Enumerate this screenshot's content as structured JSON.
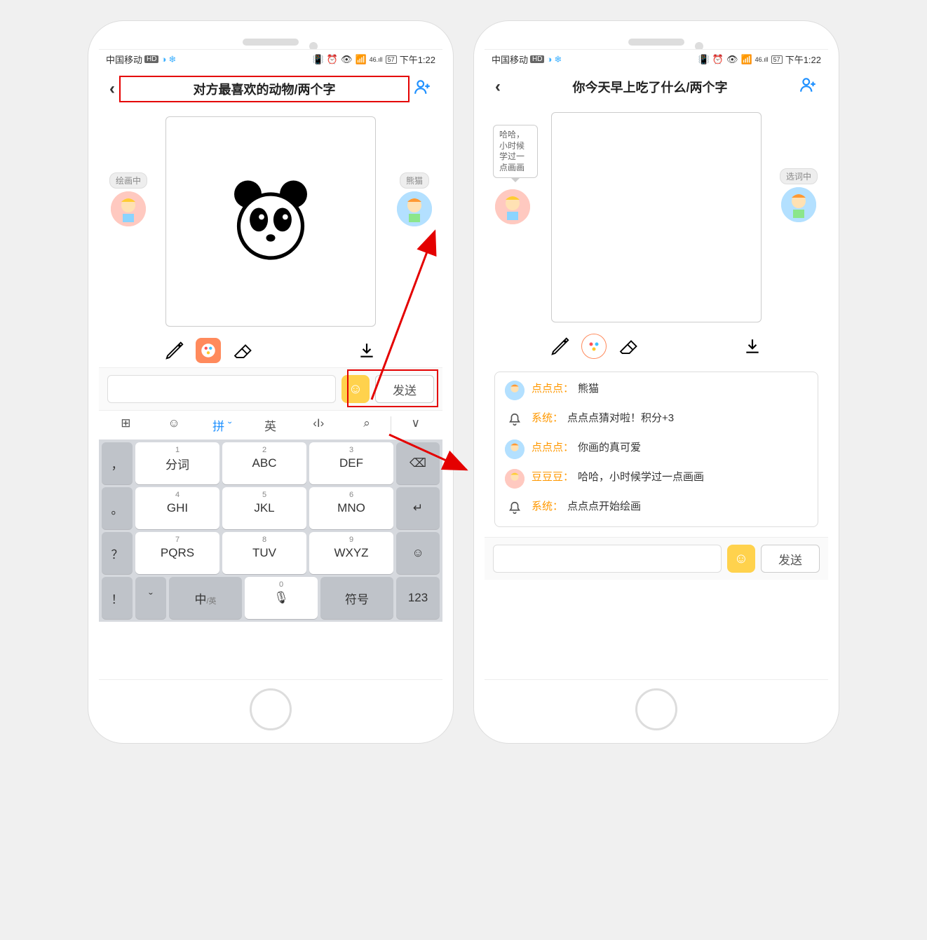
{
  "statusbar": {
    "carrier": "中国移动",
    "hd": "HD",
    "battery": "57",
    "time": "下午1:22"
  },
  "left": {
    "title": "对方最喜欢的动物/两个字",
    "avatar_left_label": "绘画中",
    "avatar_right_label": "熊猫",
    "send_label": "发送",
    "kb_modes": {
      "grid": "⊞",
      "emoji": "☺",
      "pin": "拼",
      "en": "英",
      "code": "‹I›",
      "search": "⌕",
      "down": "∨"
    },
    "keys": {
      "fenci": "分词",
      "abc": "ABC",
      "def": "DEF",
      "back": "⌫",
      "ghi": "GHI",
      "jkl": "JKL",
      "mno": "MNO",
      "enter": "↵",
      "pqrs": "PQRS",
      "tuv": "TUV",
      "wxyz": "WXYZ",
      "emo": "☺",
      "zh": "中",
      "zhs": "/英",
      "mic": "🎙",
      "sym": "符号",
      "num": "123",
      "n1": "1",
      "n2": "2",
      "n3": "3",
      "n4": "4",
      "n5": "5",
      "n6": "6",
      "n7": "7",
      "n8": "8",
      "n9": "9",
      "n0": "0"
    },
    "side": {
      "comma": "，",
      "period": "。",
      "q": "？",
      "bang": "！",
      "caret": "ˇ"
    }
  },
  "right": {
    "title": "你今天早上吃了什么/两个字",
    "bubble": "哈哈，小时候学过一点画画",
    "avatar_right_label": "选词中",
    "send_label": "发送",
    "chat": [
      {
        "type": "blue",
        "name": "点点点：",
        "text": "熊猫"
      },
      {
        "type": "bell",
        "name": "系统：",
        "text": "点点点猜对啦！积分+3"
      },
      {
        "type": "blue",
        "name": "点点点：",
        "text": "你画的真可爱"
      },
      {
        "type": "pink",
        "name": "豆豆豆：",
        "text": "哈哈，小时候学过一点画画"
      },
      {
        "type": "bell",
        "name": "系统：",
        "text": "点点点开始绘画"
      }
    ]
  }
}
